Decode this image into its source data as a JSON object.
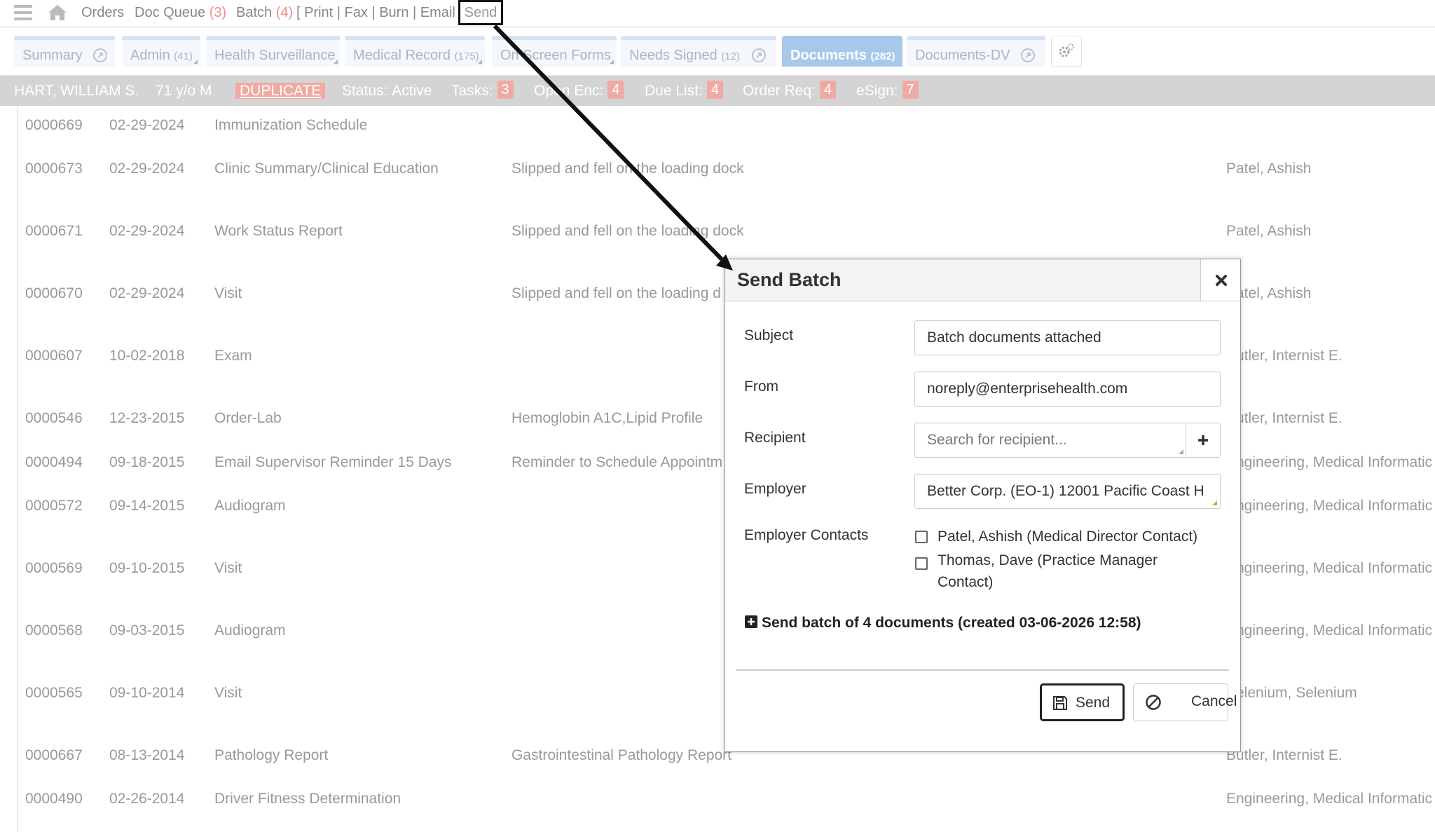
{
  "nav": {
    "orders": "Orders",
    "doc_queue": "Doc Queue",
    "doc_queue_count": "(3)",
    "batch": "Batch",
    "batch_count": "(4)",
    "batch_actions": "[ Print | Fax | Burn | Email",
    "send": "Send"
  },
  "tabs": [
    {
      "label": "Summary",
      "count": ""
    },
    {
      "label": "Admin",
      "count": "(41)"
    },
    {
      "label": "Health Surveillance",
      "count": ""
    },
    {
      "label": "Medical Record",
      "count": "(175)"
    },
    {
      "label": "On Screen Forms",
      "count": ""
    },
    {
      "label": "Needs Signed",
      "count": "(12)"
    },
    {
      "label": "Documents",
      "count": "(282)"
    },
    {
      "label": "Documents-DV",
      "count": ""
    }
  ],
  "patient": {
    "name": "HART, WILLIAM S.",
    "age_sex": "71 y/o M",
    "duplicate": "DUPLICATE",
    "status_label": "Status:",
    "status_value": "Active",
    "tasks_label": "Tasks:",
    "tasks": "3",
    "open_enc_label": "Open Enc:",
    "open_enc": "4",
    "due_list_label": "Due List:",
    "due_list": "4",
    "order_req_label": "Order Req:",
    "order_req": "4",
    "esign_label": "eSign:",
    "esign": "7"
  },
  "documents": [
    {
      "id": "0000669",
      "date": "02-29-2024",
      "type": "Immunization Schedule",
      "desc": "",
      "provider": ""
    },
    {
      "id": "0000673",
      "date": "02-29-2024",
      "type": "Clinic Summary/Clinical Education",
      "desc": "Slipped and fell on the loading dock",
      "provider": "Patel, Ashish"
    },
    {
      "id": "0000671",
      "date": "02-29-2024",
      "type": "Work Status Report",
      "desc": "Slipped and fell on the loading dock",
      "provider": "Patel, Ashish"
    },
    {
      "id": "0000670",
      "date": "02-29-2024",
      "type": "Visit",
      "desc": "Slipped and fell on the loading d",
      "provider": "Patel, Ashish"
    },
    {
      "id": "0000607",
      "date": "10-02-2018",
      "type": "Exam",
      "desc": "",
      "provider": "Butler, Internist E."
    },
    {
      "id": "0000546",
      "date": "12-23-2015",
      "type": "Order-Lab",
      "desc": "Hemoglobin A1C,Lipid Profile",
      "provider": "Butler, Internist E."
    },
    {
      "id": "0000494",
      "date": "09-18-2015",
      "type": "Email Supervisor Reminder 15 Days",
      "desc": "Reminder to Schedule Appointm",
      "provider": "Engineering, Medical Informatic"
    },
    {
      "id": "0000572",
      "date": "09-14-2015",
      "type": "Audiogram",
      "desc": "",
      "provider": "Engineering, Medical Informatic"
    },
    {
      "id": "0000569",
      "date": "09-10-2015",
      "type": "Visit",
      "desc": "",
      "provider": "Engineering, Medical Informatic"
    },
    {
      "id": "0000568",
      "date": "09-03-2015",
      "type": "Audiogram",
      "desc": "",
      "provider": "Engineering, Medical Informatic"
    },
    {
      "id": "0000565",
      "date": "09-10-2014",
      "type": "Visit",
      "desc": "",
      "provider": "Selenium, Selenium"
    },
    {
      "id": "0000667",
      "date": "08-13-2014",
      "type": "Pathology Report",
      "desc": "Gastrointestinal Pathology Report",
      "provider": "Butler, Internist E."
    },
    {
      "id": "0000490",
      "date": "02-26-2014",
      "type": "Driver Fitness Determination",
      "desc": "",
      "provider": "Engineering, Medical Informatic"
    }
  ],
  "modal": {
    "title": "Send Batch",
    "subject_label": "Subject",
    "subject_value": "Batch documents attached",
    "from_label": "From",
    "from_value": "noreply@enterprisehealth.com",
    "recipient_label": "Recipient",
    "recipient_placeholder": "Search for recipient...",
    "employer_label": "Employer",
    "employer_value": "Better Corp. (EO-1) 12001 Pacific Coast H",
    "contacts_label": "Employer Contacts",
    "contacts": [
      {
        "label": "Patel, Ashish (Medical Director Contact)",
        "checked": false
      },
      {
        "label_line1": "Thomas, Dave (Practice Manager",
        "label_line2": "Contact)",
        "checked": false
      }
    ],
    "batch_summary": "Send batch of 4 documents (created 03-06-2026 12:58)",
    "send_button": "Send",
    "cancel_button": "Cancel"
  },
  "colors": {
    "active_tab": "#a6c8ea",
    "badge": "#efaaa3",
    "patient_bar": "#d4d4d4",
    "annotation": "#111111"
  },
  "icons": {
    "menu": "hamburger-icon",
    "home": "home-icon",
    "tab_external": "external-link-icon",
    "settings": "settings-gears-icon",
    "close": "close-icon",
    "save": "floppy-disk-icon",
    "cancel": "ban-icon",
    "add": "plus-icon",
    "expand": "plus-square-icon"
  }
}
